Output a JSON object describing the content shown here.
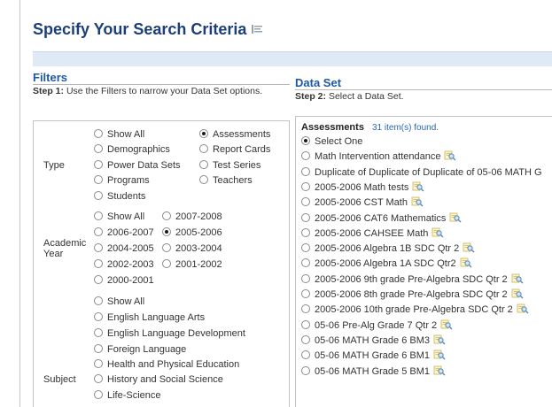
{
  "page": {
    "title": "Specify Your Search Criteria"
  },
  "filters": {
    "heading": "Filters",
    "step_label": "Step 1:",
    "step_text": "Use the Filters to narrow your Data Set options.",
    "type": {
      "label": "Type",
      "options": [
        {
          "label": "Show All",
          "selected": false
        },
        {
          "label": "Assessments",
          "selected": true
        },
        {
          "label": "Demographics",
          "selected": false
        },
        {
          "label": "Report Cards",
          "selected": false
        },
        {
          "label": "Power Data Sets",
          "selected": false
        },
        {
          "label": "Test Series",
          "selected": false
        },
        {
          "label": "Programs",
          "selected": false
        },
        {
          "label": "Teachers",
          "selected": false
        },
        {
          "label": "Students",
          "selected": false
        }
      ]
    },
    "academic_year": {
      "label_line1": "Academic",
      "label_line2": "Year",
      "options": [
        {
          "label": "Show All",
          "selected": false
        },
        {
          "label": "2007-2008",
          "selected": false
        },
        {
          "label": "2006-2007",
          "selected": false
        },
        {
          "label": "2005-2006",
          "selected": true
        },
        {
          "label": "2004-2005",
          "selected": false
        },
        {
          "label": "2003-2004",
          "selected": false
        },
        {
          "label": "2002-2003",
          "selected": false
        },
        {
          "label": "2001-2002",
          "selected": false
        },
        {
          "label": "2000-2001",
          "selected": false
        }
      ]
    },
    "subject": {
      "label": "Subject",
      "options": [
        {
          "label": "Show All",
          "selected": false
        },
        {
          "label": "English Language Arts",
          "selected": false
        },
        {
          "label": "English Language Development",
          "selected": false
        },
        {
          "label": "Foreign Language",
          "selected": false
        },
        {
          "label": "Health and Physical Education",
          "selected": false
        },
        {
          "label": "History and Social Science",
          "selected": false
        },
        {
          "label": "Life-Science",
          "selected": false
        }
      ]
    }
  },
  "dataset": {
    "heading": "Data Set",
    "step_label": "Step 2:",
    "step_text": "Select a Data Set.",
    "list_title": "Assessments",
    "count_text": "31 item(s) found.",
    "items": [
      {
        "label": "Select One",
        "selected": true,
        "icon": false
      },
      {
        "label": "Math Intervention attendance",
        "selected": false,
        "icon": true
      },
      {
        "label": "Duplicate of Duplicate of Duplicate of 05-06 MATH G",
        "selected": false,
        "icon": false
      },
      {
        "label": "2005-2006 Math tests",
        "selected": false,
        "icon": true
      },
      {
        "label": "2005-2006 CST Math",
        "selected": false,
        "icon": true
      },
      {
        "label": "2005-2006 CAT6 Mathematics",
        "selected": false,
        "icon": true
      },
      {
        "label": "2005-2006 CAHSEE Math",
        "selected": false,
        "icon": true
      },
      {
        "label": "2005-2006 Algebra 1B SDC Qtr 2",
        "selected": false,
        "icon": true
      },
      {
        "label": "2005-2006 Algebra 1A SDC Qtr2",
        "selected": false,
        "icon": true
      },
      {
        "label": "2005-2006 9th grade Pre-Algebra SDC Qtr 2",
        "selected": false,
        "icon": true
      },
      {
        "label": "2005-2006 8th grade Pre-Algebra SDC Qtr 2",
        "selected": false,
        "icon": true
      },
      {
        "label": "2005-2006 10th grade Pre-Algebra SDC Qtr 2",
        "selected": false,
        "icon": true
      },
      {
        "label": "05-06 Pre-Alg Grade 7 Qtr 2",
        "selected": false,
        "icon": true
      },
      {
        "label": "05-06 MATH Grade 6 BM3",
        "selected": false,
        "icon": true
      },
      {
        "label": "05-06 MATH Grade 6 BM1",
        "selected": false,
        "icon": true
      },
      {
        "label": "05-06 MATH Grade 5 BM1",
        "selected": false,
        "icon": true
      }
    ],
    "info_icon": "magnifier-note-icon"
  }
}
